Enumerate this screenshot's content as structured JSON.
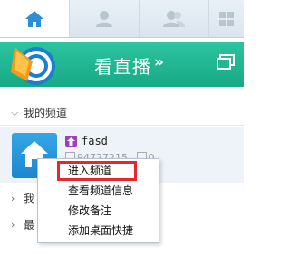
{
  "tabs": [
    {
      "id": "home",
      "icon": "home-icon",
      "active": true
    },
    {
      "id": "profile",
      "icon": "user-icon",
      "active": false
    },
    {
      "id": "contacts",
      "icon": "contacts-icon",
      "active": false
    },
    {
      "id": "apps",
      "icon": "grid-icon",
      "active": false
    }
  ],
  "banner": {
    "title": "看直播",
    "chevrons": "»",
    "accent": "#1fb893"
  },
  "sections": {
    "my_channels": "我的频道",
    "section2": "我",
    "section3": "最"
  },
  "channel": {
    "name": "fasd",
    "id_text": "94727215",
    "count": "0"
  },
  "context_menu": {
    "items": [
      "进入频道",
      "查看频道信息",
      "修改备注",
      "添加桌面快捷"
    ],
    "highlight_color": "#e8262f"
  }
}
